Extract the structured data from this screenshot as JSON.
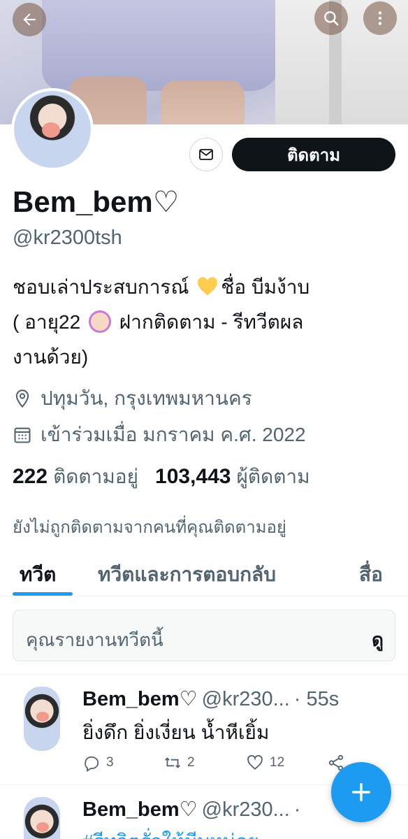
{
  "profile": {
    "name": "Bem_bem♡",
    "handle": "@kr2300tsh",
    "bio_line1": "ชอบเล่าประสบการณ์",
    "bio_line1b": "ชื่อ บีมง้าบ",
    "bio_line2a": "( อายุ22",
    "bio_line2b": "ฝากติดตาม - รีทวีตผล",
    "bio_line3": "งานด้วย)",
    "location": "ปทุมวัน, กรุงเทพมหานคร",
    "joined": "เข้าร่วมเมื่อ มกราคม ค.ศ. 2022",
    "following_count": "222",
    "following_label": "ติดตามอยู่",
    "followers_count": "103,443",
    "followers_label": "ผู้ติดตาม",
    "not_followed_note": "ยังไม่ถูกติดตามจากคนที่คุณติดตามอยู่"
  },
  "buttons": {
    "follow": "ติดตาม"
  },
  "tabs": [
    {
      "label": "ทวีต",
      "active": true
    },
    {
      "label": "ทวีตและการตอบกลับ",
      "active": false
    },
    {
      "label": "สื่อ",
      "active": false
    }
  ],
  "report_notice": {
    "text": "คุณรายงานทวีตนี้",
    "action": "ดู"
  },
  "tweets": [
    {
      "name": "Bem_bem♡",
      "handle": "@kr230...",
      "time": "· 55s",
      "text": "ยิ่งดึก ยิ่งเงี่ยน น้ำหีเยิ้ม",
      "replies": "3",
      "retweets": "2",
      "likes": "12"
    },
    {
      "name": "Bem_bem♡",
      "handle": "@kr230...",
      "time": "·",
      "text": "#รีทวิตรั่วให้มีบหน่อย"
    }
  ],
  "colors": {
    "accent": "#1d9bf0",
    "text_primary": "#0f1419",
    "text_secondary": "#536471",
    "follow_bg": "#0f1419"
  },
  "icons": {
    "back": "arrow-left-icon",
    "search": "search-icon",
    "more": "more-vertical-icon",
    "message": "mail-icon",
    "location": "location-pin-icon",
    "calendar": "calendar-icon",
    "reply": "reply-icon",
    "retweet": "retweet-icon",
    "like": "heart-icon",
    "share": "share-icon",
    "compose": "plus-icon"
  }
}
